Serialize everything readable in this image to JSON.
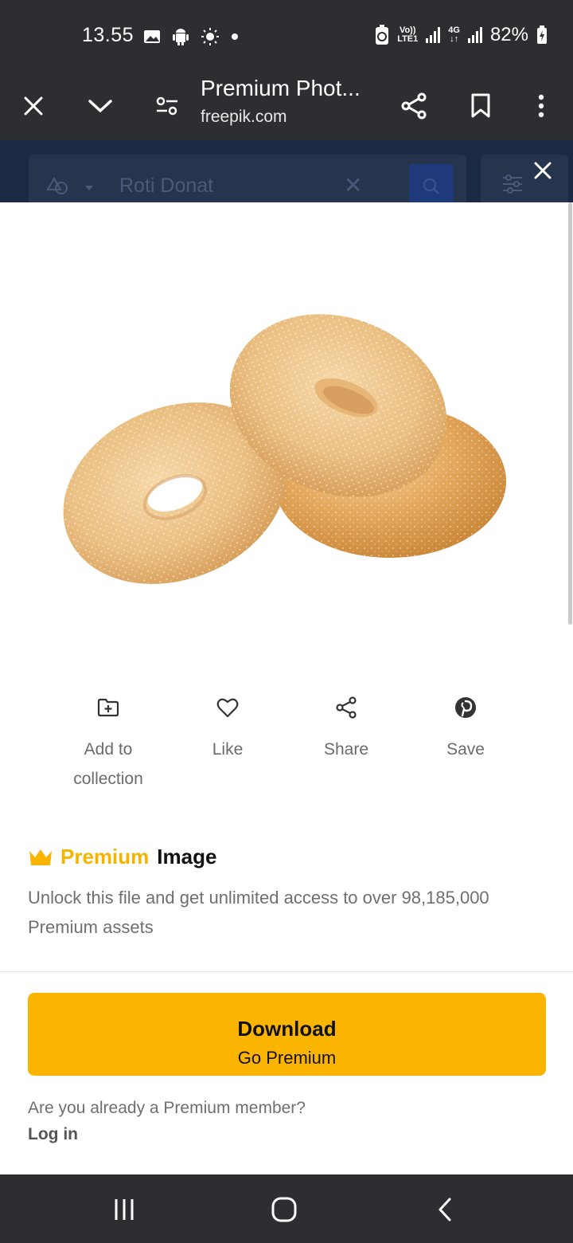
{
  "status_bar": {
    "time": "13.55",
    "volte_label": "Vo))",
    "lte_label": "LTE1",
    "net_label": "4G",
    "battery": "82%"
  },
  "toolbar": {
    "page_title": "Premium Phot...",
    "url": "freepik.com"
  },
  "background_page": {
    "search_text": "Roti Donat"
  },
  "actions": [
    {
      "label": "Add to collection",
      "icon": "add-to-folder-icon"
    },
    {
      "label": "Like",
      "icon": "heart-icon"
    },
    {
      "label": "Share",
      "icon": "share-icon"
    },
    {
      "label": "Save",
      "icon": "pinterest-icon"
    }
  ],
  "premium": {
    "badge_word": "Premium",
    "type_word": "Image",
    "description": "Unlock this file and get unlimited access to over 98,185,000 Premium assets"
  },
  "download": {
    "title": "Download",
    "subtitle": "Go Premium"
  },
  "member": {
    "question": "Are you already a Premium member?",
    "login": "Log in"
  },
  "colors": {
    "accent": "#fbb500",
    "premium_text": "#f5b400",
    "chrome": "#2d2e31"
  }
}
